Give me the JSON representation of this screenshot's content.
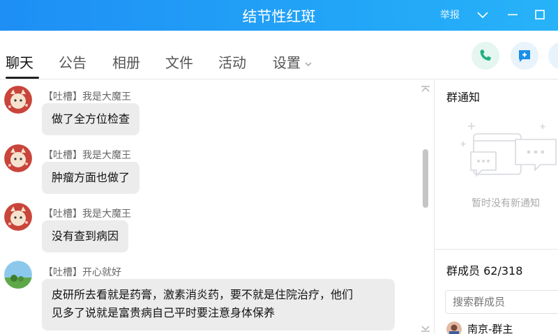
{
  "window": {
    "title": "结节性红斑",
    "report_label": "举报"
  },
  "tabs": [
    {
      "label": "聊天",
      "active": true
    },
    {
      "label": "公告",
      "active": false
    },
    {
      "label": "相册",
      "active": false
    },
    {
      "label": "文件",
      "active": false
    },
    {
      "label": "活动",
      "active": false
    },
    {
      "label": "设置",
      "active": false
    }
  ],
  "messages": [
    {
      "sender": "【吐槽】我是大魔王",
      "lines": [
        "做了全方位检查"
      ]
    },
    {
      "sender": "【吐槽】我是大魔王",
      "lines": [
        "肿瘤方面也做了"
      ]
    },
    {
      "sender": "【吐槽】我是大魔王",
      "lines": [
        "没有查到病因"
      ]
    },
    {
      "sender": "【吐槽】开心就好",
      "lines": [
        "皮研所去看就是药膏，激素消炎药，要不就是住院治疗，他们",
        "见多了说就是富贵病自己平时要注意身体保养"
      ]
    }
  ],
  "notice": {
    "title": "群通知",
    "empty_text": "暂时没有新通知"
  },
  "members": {
    "title": "群成员 62/318",
    "search_placeholder": "搜索群成员",
    "first_member": "南京-群主"
  },
  "colors": {
    "titlebar_start": "#1e8ff5",
    "titlebar_end": "#27b3f8",
    "bubble": "#ececec",
    "phone_icon": "#22b07d",
    "chat_icon": "#1a8fe8"
  }
}
